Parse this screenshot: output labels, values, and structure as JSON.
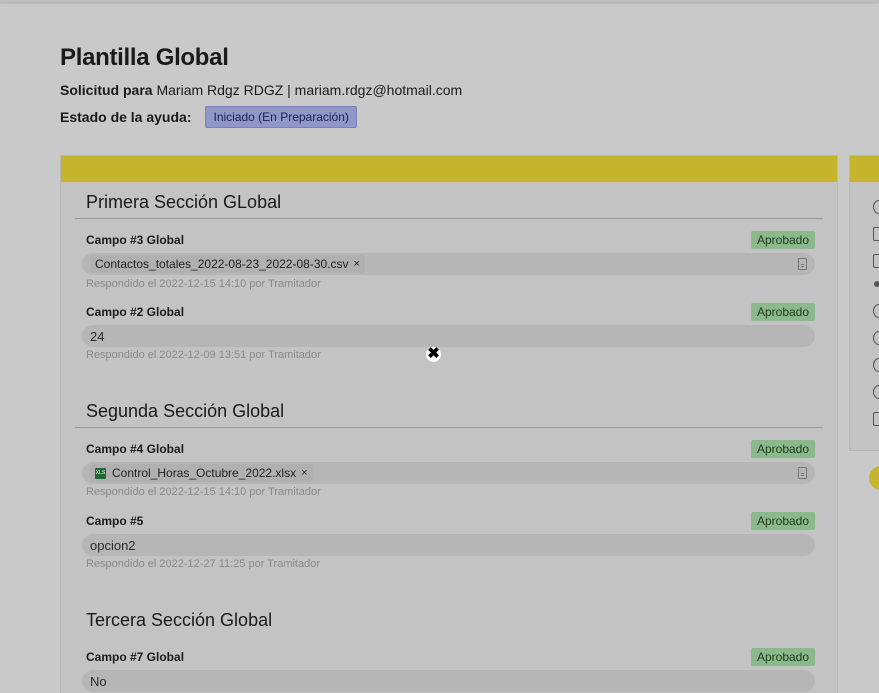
{
  "page": {
    "title": "Plantilla Global",
    "request_label": "Solicitud para",
    "request_value": "Mariam Rdgz RDGZ | mariam.rdgz@hotmail.com",
    "status_label": "Estado de la ayuda:",
    "status_value": "Iniciado (En Preparación)"
  },
  "sections": [
    {
      "title": "Primera Sección GLobal",
      "fields": [
        {
          "label": "Campo #3 Global",
          "badge": "Aprobado",
          "file": "Contactos_totales_2022-08-23_2022-08-30.csv",
          "remove": "×",
          "meta": "Respondido el 2022-12-15 14:10 por Tramitador"
        },
        {
          "label": "Campo #2 Global",
          "badge": "Aprobado",
          "value": "24",
          "meta": "Respondido el 2022-12-09 13:51 por Tramitador"
        }
      ]
    },
    {
      "title": "Segunda Sección Global",
      "fields": [
        {
          "label": "Campo #4 Global",
          "badge": "Aprobado",
          "file": "Control_Horas_Octubre_2022.xlsx",
          "remove": "×",
          "file_icon_text": "XLS",
          "meta": "Respondido el 2022-12-15 14:10 por Tramitador"
        },
        {
          "label": "Campo #5",
          "badge": "Aprobado",
          "value": "opcion2",
          "meta": "Respondido el 2022-12-27 11:25 por Tramitador"
        }
      ]
    },
    {
      "title": "Tercera Sección Global",
      "fields": [
        {
          "label": "Campo #7 Global",
          "badge": "Aprobado",
          "value": "No"
        }
      ]
    }
  ],
  "overlay": {
    "cursor_glyph": "✖"
  },
  "colors": {
    "accent": "#c6b52c",
    "approved_bg": "#8cb98c",
    "status_bg": "#8f96c8",
    "background": "#c9c9c9"
  },
  "icons": [
    "clock-icon",
    "document-icon",
    "calendar-icon",
    "dot-icon",
    "chat-icon",
    "user-icon",
    "history-icon",
    "info-icon",
    "list-icon"
  ]
}
